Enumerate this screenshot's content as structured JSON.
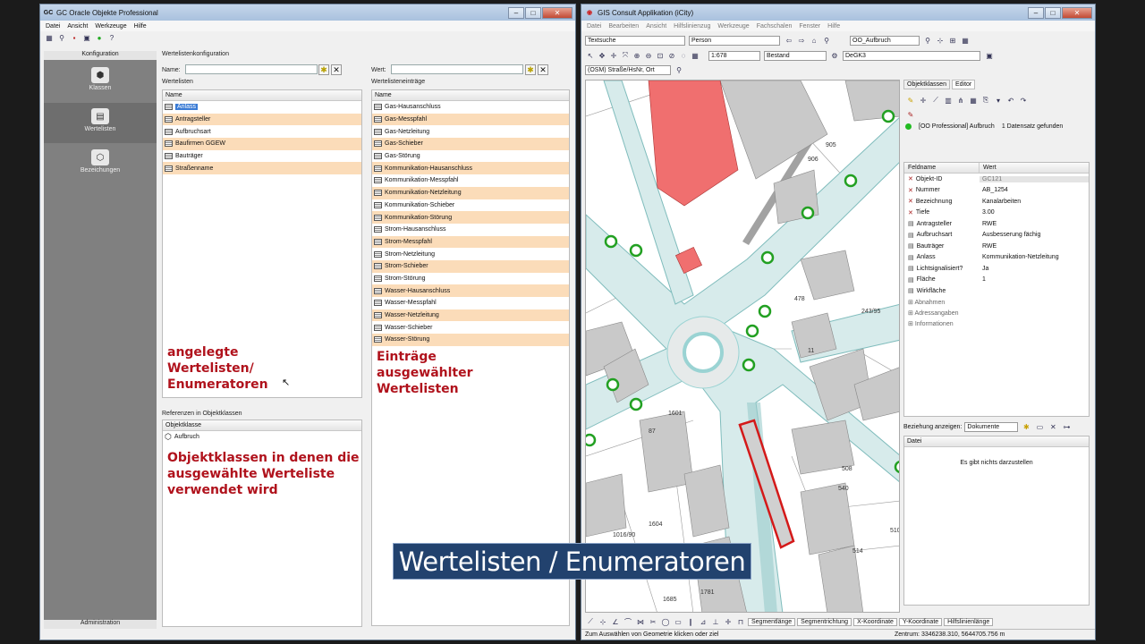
{
  "left_window": {
    "title": "GC Oracle Objekte Professional",
    "menu": [
      "Datei",
      "Ansicht",
      "Werkzeuge",
      "Hilfe"
    ],
    "nav_header": "Konfiguration",
    "nav_items": [
      "Klassen",
      "Wertelisten",
      "Bezeichungen"
    ],
    "nav_footer": "Administration",
    "section_title": "Wertelistenkonfiguration",
    "name_label": "Name:",
    "wert_label": "Wert:",
    "wertelisten_label": "Wertelisten",
    "eintraege_label": "Wertelisteneinträge",
    "col_name": "Name",
    "wertelisten": [
      "Anlass",
      "Antragsteller",
      "Aufbruchsart",
      "Baufirmen GGEW",
      "Bauträger",
      "Straßenname"
    ],
    "eintraege": [
      "Gas-Hausanschluss",
      "Gas-Messpfahl",
      "Gas-Netzleitung",
      "Gas-Schieber",
      "Gas-Störung",
      "Kommunikation-Hausanschluss",
      "Kommunikation-Messpfahl",
      "Kommunikation-Netzleitung",
      "Kommunikation-Schieber",
      "Kommunikation-Störung",
      "Strom-Hausanschluss",
      "Strom-Messpfahl",
      "Strom-Netzleitung",
      "Strom-Schieber",
      "Strom-Störung",
      "Wasser-Hausanschluss",
      "Wasser-Messpfahl",
      "Wasser-Netzleitung",
      "Wasser-Schieber",
      "Wasser-Störung"
    ],
    "referenzen_title": "Referenzen in Objektklassen",
    "col_objektklasse": "Objektklasse",
    "referenzen": [
      "Aufbruch"
    ],
    "annotation_left": [
      "angelegte",
      "Wertelisten/",
      "Enumeratoren"
    ],
    "annotation_right": [
      "Einträge",
      "ausgewählter",
      "Wertelisten"
    ],
    "annotation_bottom": [
      "Objektklassen in denen die",
      "ausgewählte Werteliste",
      "verwendet wird"
    ]
  },
  "right_window": {
    "title": "GIS Consult Applikation (iCity)",
    "menu": [
      "Datei",
      "Bearbeiten",
      "Ansicht",
      "Hilfslinienzug",
      "Werkzeuge",
      "Fachschalen",
      "Fenster",
      "Hilfe"
    ],
    "combo_textsuche": "Textsuche",
    "combo_person": "Person",
    "combo_aufbruch": "OO_Aufbruch",
    "combo_scale": "1:678",
    "combo_bestand": "Bestand",
    "combo_crs": "DeGK3",
    "search_field": "(OSM) Straße/HsNr, Ort",
    "tabs": [
      "Objektklassen",
      "Editor"
    ],
    "result_text": "[OO Professional] Aufbruch",
    "result_count": "1 Datensatz gefunden",
    "col_feldname": "Feldname",
    "col_wert": "Wert",
    "properties": [
      {
        "k": "Objekt-ID",
        "v": "GC121"
      },
      {
        "k": "Nummer",
        "v": "AB_1254"
      },
      {
        "k": "Bezeichnung",
        "v": "Kanalarbeiten"
      },
      {
        "k": "Tiefe",
        "v": "3.00"
      },
      {
        "k": "Antragsteller",
        "v": "RWE"
      },
      {
        "k": "Aufbruchsart",
        "v": "Ausbesserung fächig"
      },
      {
        "k": "Bauträger",
        "v": "RWE"
      },
      {
        "k": "Anlass",
        "v": "Kommunikation-Netzleitung"
      },
      {
        "k": "Lichtsignalisiert?",
        "v": "Ja"
      },
      {
        "k": "Fläche",
        "v": "1"
      },
      {
        "k": "Wirkfläche",
        "v": ""
      }
    ],
    "groups": [
      "Abnahmen",
      "Adressangaben",
      "Informationen"
    ],
    "relation_label": "Beziehung anzeigen:",
    "relation_value": "Dokumente",
    "col_datei": "Datei",
    "empty_text": "Es gibt nichts darzustellen",
    "bottom_tabs": [
      "Segmentlänge",
      "Segmentrichtung",
      "X-Koordinate",
      "Y-Koordinate",
      "Hilfslinienlänge"
    ],
    "status_left": "Zum Auswählen von Geometrie klicken oder ziel",
    "status_right": "Zentrum: 3346238.310, 5644705.756 m",
    "map_labels": [
      "905",
      "906",
      "1601",
      "1604",
      "1016/90",
      "1685",
      "1781",
      "478",
      "243/95",
      "508",
      "514",
      "510",
      "540",
      "87",
      "11"
    ]
  },
  "caption": "Wertelisten / Enumeratoren",
  "colors": {
    "highlight": "#fbdcb9",
    "annotation": "#b0121c",
    "caption_bg": "#22426e",
    "map_building": "#c9c9c9",
    "map_road": "#d7ebeb",
    "map_red_building": "#f06f6f"
  }
}
